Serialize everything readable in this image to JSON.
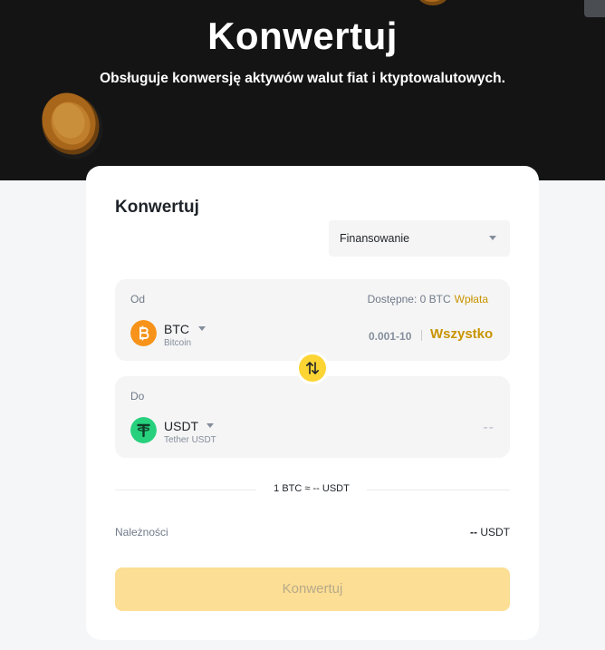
{
  "hero": {
    "title": "Konwertuj",
    "subtitle": "Obsługuje konwersję aktywów walut fiat i ktyptowalutowych."
  },
  "card": {
    "title": "Konwertuj",
    "wallet": {
      "selected": "Finansowanie",
      "icon": "chevron-down-icon"
    },
    "from": {
      "label": "Od",
      "available_text": "Dostępne: 0 BTC",
      "deposit_label": "Wpłata",
      "asset_symbol": "BTC",
      "asset_name": "Bitcoin",
      "asset_icon": "bitcoin-icon",
      "range": "0.001-10",
      "max_label": "Wszystko"
    },
    "to": {
      "label": "Do",
      "asset_symbol": "USDT",
      "asset_name": "Tether USDT",
      "asset_icon": "tether-icon",
      "amount": "--"
    },
    "swap_icon": "swap-arrows-icon",
    "rate_text": "1 BTC ≈ -- USDT",
    "receive": {
      "label": "Należności",
      "value_dash": "--",
      "value_unit": "USDT"
    },
    "convert_button": "Konwertuj"
  },
  "colors": {
    "accent": "#fcd535",
    "accent_text": "#c99400",
    "bitcoin": "#f7931a",
    "tether": "#26a17b",
    "hero_bg": "#141414"
  }
}
